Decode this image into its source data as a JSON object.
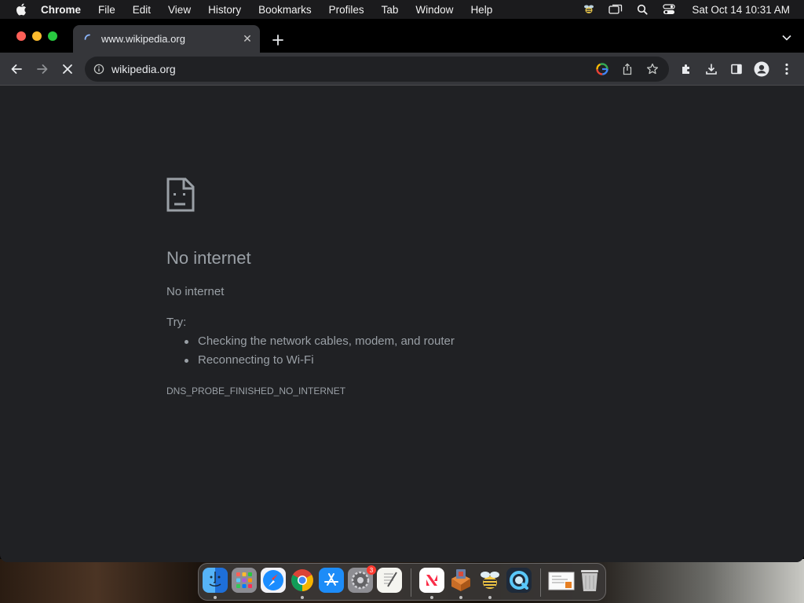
{
  "menubar": {
    "app_name": "Chrome",
    "items": [
      "File",
      "Edit",
      "View",
      "History",
      "Bookmarks",
      "Profiles",
      "Tab",
      "Window",
      "Help"
    ],
    "clock": "Sat Oct 14  10:31 AM"
  },
  "tab": {
    "title": "www.wikipedia.org",
    "close_glyph": "✕"
  },
  "omnibox": {
    "url": "wikipedia.org"
  },
  "error_page": {
    "title": "No internet",
    "subtitle": "No internet",
    "try_label": "Try:",
    "suggestions": [
      "Checking the network cables, modem, and router",
      "Reconnecting to Wi-Fi"
    ],
    "error_code": "DNS_PROBE_FINISHED_NO_INTERNET"
  },
  "dock": {
    "apps": [
      "finder-icon",
      "launchpad-icon",
      "safari-icon",
      "chrome-icon",
      "app-store-icon",
      "system-settings-icon",
      "textedit-icon",
      "news-icon",
      "archive-utility-icon",
      "cyberduck-icon",
      "quicktime-icon",
      "document-preview-icon",
      "trash-icon"
    ],
    "settings_badge": "3"
  },
  "colors": {
    "accent_red": "#fe5f57",
    "accent_yellow": "#febc2e",
    "accent_green": "#28c840",
    "error_text": "#9aa0a6",
    "page_bg": "#202124"
  }
}
